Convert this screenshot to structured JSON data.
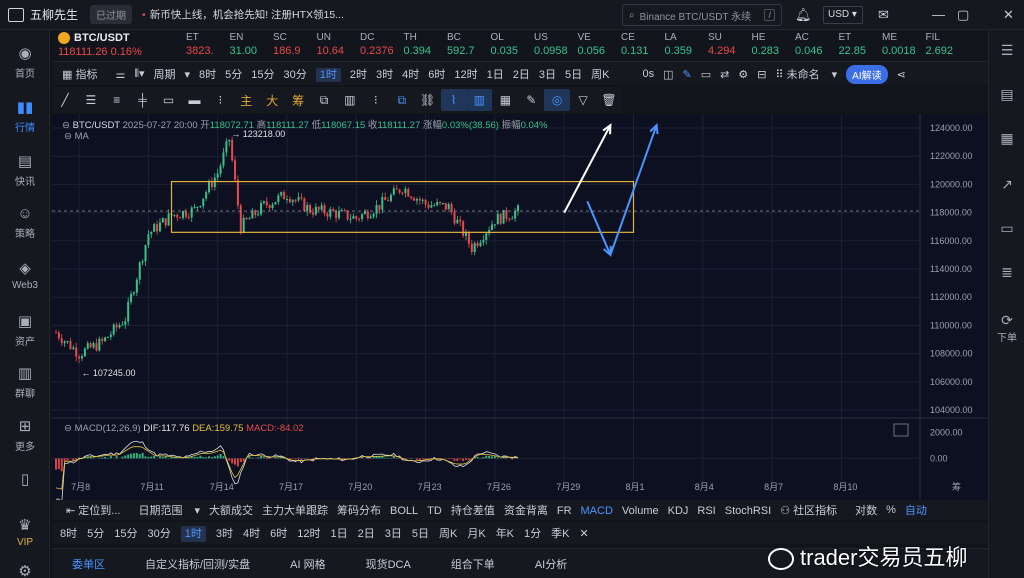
{
  "topbar": {
    "app_title": "五柳先生",
    "expired_badge": "已过期",
    "news": "新币快上线，机会抢先知! 注册HTX领15...",
    "search_placeholder": "Binance BTC/USDT 永续",
    "search_shortcut": "/",
    "currency": "USD"
  },
  "left_nav": [
    {
      "label": "首页",
      "icon": "home-icon"
    },
    {
      "label": "行情",
      "icon": "chart-bars-icon",
      "active": true
    },
    {
      "label": "快讯",
      "icon": "news-icon"
    },
    {
      "label": "策略",
      "icon": "robot-icon"
    },
    {
      "label": "Web3",
      "icon": "web3-icon"
    },
    {
      "label": "资产",
      "icon": "wallet-icon"
    },
    {
      "label": "群聊",
      "icon": "chat-icon"
    },
    {
      "label": "更多",
      "icon": "grid-icon"
    },
    {
      "label": "",
      "icon": "phone-icon"
    },
    {
      "label": "VIP",
      "icon": "vip-icon"
    }
  ],
  "right_bar": {
    "order_label": "下单"
  },
  "ticker": {
    "main": {
      "symbol": "BTC/USDT",
      "price": "118111.26",
      "change": "0.16%"
    },
    "items": [
      {
        "symbol": "ET",
        "value": "3823.",
        "dir": "dn"
      },
      {
        "symbol": "EN",
        "value": "31.00",
        "dir": "up"
      },
      {
        "symbol": "SC",
        "value": "186.9",
        "dir": "dn"
      },
      {
        "symbol": "UN",
        "value": "10.64",
        "dir": "dn"
      },
      {
        "symbol": "DC",
        "value": "0.2376",
        "dir": "dn"
      },
      {
        "symbol": "TH",
        "value": "0.394",
        "dir": "up"
      },
      {
        "symbol": "BC",
        "value": "592.7",
        "dir": "up"
      },
      {
        "symbol": "OL",
        "value": "0.035",
        "dir": "up"
      },
      {
        "symbol": "US",
        "value": "0.0958",
        "dir": "up"
      },
      {
        "symbol": "VE",
        "value": "0.056",
        "dir": "up"
      },
      {
        "symbol": "CE",
        "value": "0.131",
        "dir": "up"
      },
      {
        "symbol": "LA",
        "value": "0.359",
        "dir": "up"
      },
      {
        "symbol": "SU",
        "value": "4.294",
        "dir": "dn"
      },
      {
        "symbol": "HE",
        "value": "0.283",
        "dir": "up"
      },
      {
        "symbol": "AC",
        "value": "0.046",
        "dir": "up"
      },
      {
        "symbol": "ET",
        "value": "22.85",
        "dir": "up"
      },
      {
        "symbol": "ME",
        "value": "0.0018",
        "dir": "up"
      },
      {
        "symbol": "FIL",
        "value": "2.692",
        "dir": "up"
      }
    ]
  },
  "toolbar1": {
    "indicators": "指标",
    "period": "周期",
    "intervals": [
      "8时",
      "5分",
      "15分",
      "30分",
      "1时",
      "2时",
      "3时",
      "4时",
      "6时",
      "12时",
      "1日",
      "2日",
      "3日",
      "5日",
      "周K"
    ],
    "selected_interval": "1时",
    "countdown": "0s",
    "unnamed": "未命名",
    "ai_button": "AI解读"
  },
  "toolbar2": {
    "labels": [
      "主",
      "大",
      "筹"
    ]
  },
  "chart_legend": {
    "symbol": "BTC/USDT",
    "datetime": "2025-07-27 20:00",
    "open_label": "开",
    "open": "118072.71",
    "high_label": "高",
    "high": "118111.27",
    "low_label": "低",
    "low": "118067.15",
    "close_label": "收",
    "close": "118111.27",
    "change_label": "涨幅",
    "change": "0.03%(38.56)",
    "amp_label": "振幅",
    "amp": "0.04%",
    "ma_label": "MA"
  },
  "macd_legend": {
    "name": "MACD(12,26,9)",
    "dif": "DIF:117.76",
    "dea": "DEA:159.75",
    "macd": "MACD:-84.02"
  },
  "chart_data": {
    "type": "candlestick",
    "symbol": "BTC/USDT",
    "price_axis": [
      "124000.00",
      "122000.00",
      "120000.00",
      "118000.00",
      "116000.00",
      "114000.00",
      "112000.00",
      "110000.00",
      "108000.00",
      "106000.00",
      "104000.00"
    ],
    "ylim": [
      104000,
      124000
    ],
    "x_labels": [
      "7月8",
      "7月11",
      "7月14",
      "7月17",
      "7月20",
      "7月23",
      "7月26",
      "7月29",
      "8月1",
      "8月4",
      "8月7",
      "8月10"
    ],
    "x_extra": "筹",
    "close_path": [
      [
        "7月7",
        109500
      ],
      [
        "7月8",
        108000
      ],
      [
        "7月9",
        108800
      ],
      [
        "7月10",
        110500
      ],
      [
        "7月11",
        116500
      ],
      [
        "7月12",
        117800
      ],
      [
        "7月13",
        118200
      ],
      [
        "7月14",
        120800
      ],
      [
        "7月14 12:00",
        123218
      ],
      [
        "7月15",
        117000
      ],
      [
        "7月16",
        118500
      ],
      [
        "7月17",
        119300
      ],
      [
        "7月18",
        118200
      ],
      [
        "7月19",
        118000
      ],
      [
        "7月20",
        117600
      ],
      [
        "7月21",
        118500
      ],
      [
        "7月22",
        119800
      ],
      [
        "7月23",
        118600
      ],
      [
        "7月24",
        118400
      ],
      [
        "7月25",
        115500
      ],
      [
        "7月26",
        117500
      ],
      [
        "7月27",
        118111
      ]
    ],
    "high_label": "123218.00",
    "low_label": "107245.00",
    "current_price": 118111.27,
    "range_box": {
      "top": 120200,
      "bottom": 116600,
      "start": "7月12",
      "end": "8月1"
    },
    "arrows": [
      {
        "color": "#ffffff",
        "from": [
          "7月29",
          118000
        ],
        "to": [
          "7月31",
          124200
        ]
      },
      {
        "color": "#4a95ff",
        "from": [
          "7月30",
          118800
        ],
        "to": [
          "7月31",
          115000
        ]
      },
      {
        "color": "#4a95ff",
        "from": [
          "7月31",
          115000
        ],
        "to": [
          "8月2",
          124200
        ]
      }
    ],
    "macd_axis": [
      "2000.00",
      "0.00"
    ],
    "macd_ylim": [
      -1200,
      2800
    ]
  },
  "bottom_toolbar": {
    "locate": "定位到...",
    "date_range": "日期范围",
    "items": [
      "大额成交",
      "主力大单跟踪",
      "筹码分布",
      "BOLL",
      "TD",
      "持仓差值",
      "资金背离",
      "FR",
      "MACD",
      "Volume",
      "KDJ",
      "RSI",
      "StochRSI"
    ],
    "selected": "MACD",
    "community": "社区指标",
    "log": "对数",
    "percent": "%",
    "auto": "自动"
  },
  "period_bar": {
    "items": [
      "8时",
      "5分",
      "15分",
      "30分",
      "1时",
      "3时",
      "4时",
      "6时",
      "12时",
      "1日",
      "2日",
      "3日",
      "5日",
      "周K",
      "月K",
      "年K",
      "1分",
      "季K"
    ],
    "selected": "1时"
  },
  "bottom_tabs": [
    "委单区",
    "自定义指标/回测/实盘",
    "AI 网格",
    "现货DCA",
    "组合下单",
    "AI分析"
  ],
  "watermark": "trader交易员五柳"
}
